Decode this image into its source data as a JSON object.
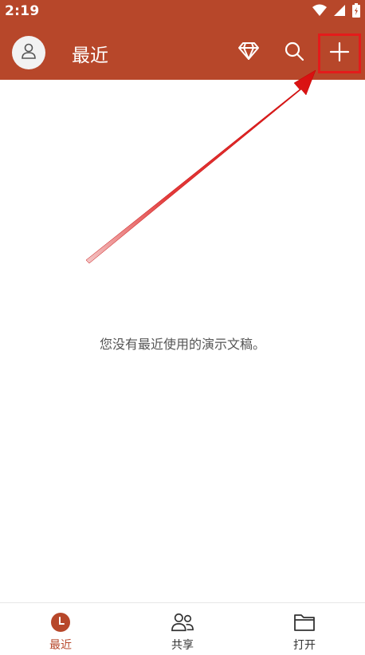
{
  "status_bar": {
    "time": "2:19"
  },
  "app_bar": {
    "title": "最近"
  },
  "main": {
    "empty_message": "您没有最近使用的演示文稿。"
  },
  "bottom_nav": {
    "items": [
      {
        "label": "最近",
        "icon": "clock-icon",
        "active": true
      },
      {
        "label": "共享",
        "icon": "people-icon",
        "active": false
      },
      {
        "label": "打开",
        "icon": "folder-icon",
        "active": false
      }
    ]
  },
  "colors": {
    "brand": "#b7472a",
    "annotation": "#e41b1b"
  }
}
